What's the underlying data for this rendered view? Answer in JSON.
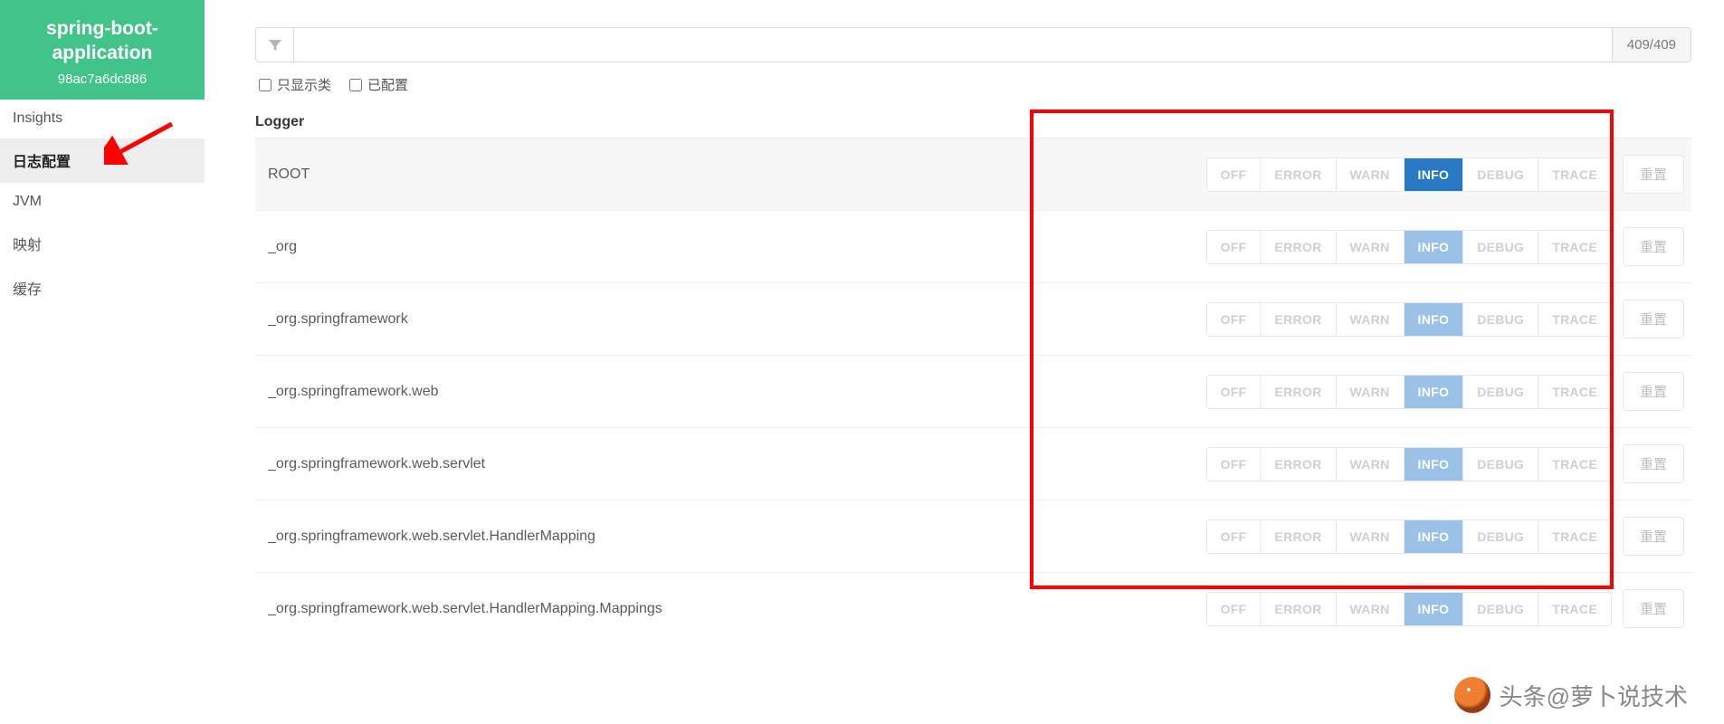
{
  "app": {
    "title": "spring-boot-application",
    "id": "98ac7a6dc886"
  },
  "sidebar": {
    "items": [
      {
        "label": "Insights"
      },
      {
        "label": "日志配置",
        "active": true
      },
      {
        "label": "JVM"
      },
      {
        "label": "映射"
      },
      {
        "label": "缓存"
      }
    ]
  },
  "filter": {
    "count": "409/409",
    "placeholder": ""
  },
  "checkboxes": {
    "only_classes": "只显示类",
    "configured": "已配置"
  },
  "section": {
    "logger_title": "Logger"
  },
  "levels": [
    "OFF",
    "ERROR",
    "WARN",
    "INFO",
    "DEBUG",
    "TRACE"
  ],
  "reset_label": "重置",
  "loggers": [
    {
      "name": "ROOT",
      "selected": "INFO",
      "strong": true,
      "root": true
    },
    {
      "name": "_org",
      "selected": "INFO",
      "strong": false
    },
    {
      "name": "_org.springframework",
      "selected": "INFO",
      "strong": false
    },
    {
      "name": "_org.springframework.web",
      "selected": "INFO",
      "strong": false
    },
    {
      "name": "_org.springframework.web.servlet",
      "selected": "INFO",
      "strong": false
    },
    {
      "name": "_org.springframework.web.servlet.HandlerMapping",
      "selected": "INFO",
      "strong": false
    },
    {
      "name": "_org.springframework.web.servlet.HandlerMapping.Mappings",
      "selected": "INFO",
      "strong": false
    }
  ],
  "watermark": "头条@萝卜说技术"
}
